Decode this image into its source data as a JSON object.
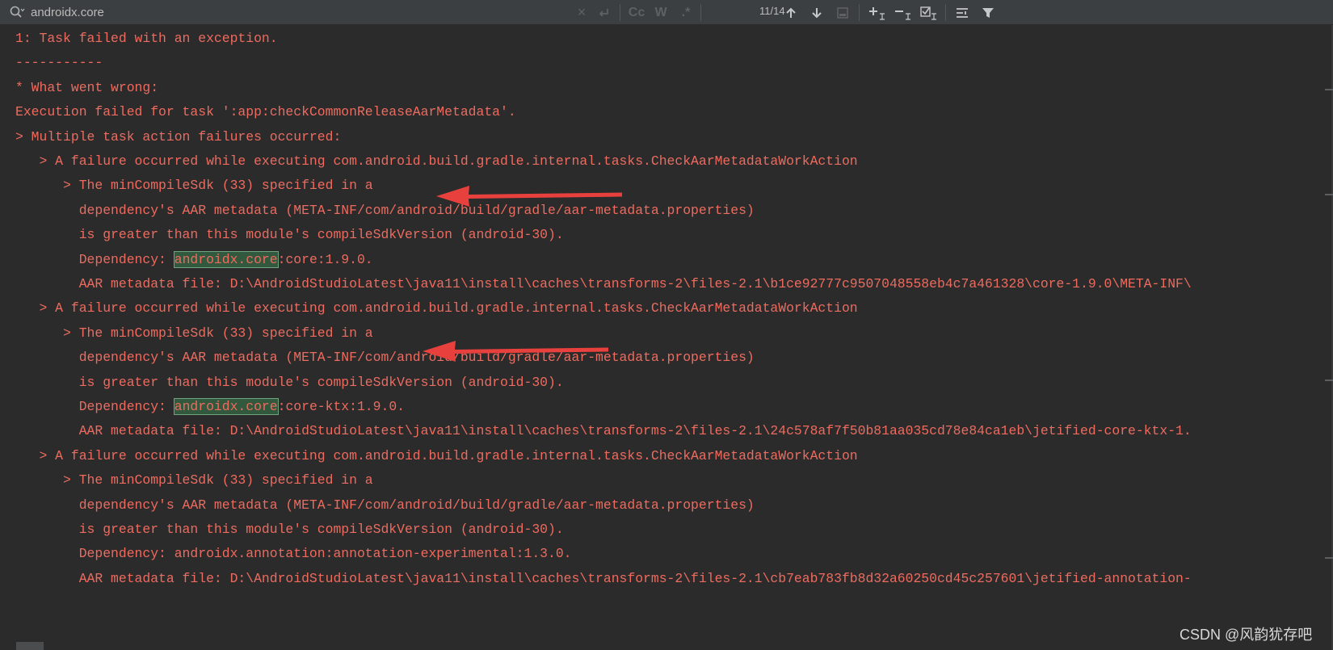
{
  "search": {
    "value": "androidx.core",
    "match_counter": "11/14",
    "toggle_case": "Cc",
    "toggle_words": "W",
    "toggle_regex": ".*"
  },
  "console": {
    "lines": [
      "1: Task failed with an exception.",
      "-----------",
      "* What went wrong:",
      "Execution failed for task ':app:checkCommonReleaseAarMetadata'.",
      "> Multiple task action failures occurred:",
      "   > A failure occurred while executing com.android.build.gradle.internal.tasks.CheckAarMetadataWorkAction",
      "      > The minCompileSdk (33) specified in a",
      "        dependency's AAR metadata (META-INF/com/android/build/gradle/aar-metadata.properties)",
      "        is greater than this module's compileSdkVersion (android-30).",
      {
        "prefix": "        Dependency: ",
        "match": "androidx.core",
        "suffix": ":core:1.9.0."
      },
      "        AAR metadata file: D:\\AndroidStudioLatest\\java11\\install\\caches\\transforms-2\\files-2.1\\b1ce92777c9507048558eb4c7a461328\\core-1.9.0\\META-INF\\",
      "   > A failure occurred while executing com.android.build.gradle.internal.tasks.CheckAarMetadataWorkAction",
      "      > The minCompileSdk (33) specified in a",
      "        dependency's AAR metadata (META-INF/com/android/build/gradle/aar-metadata.properties)",
      "        is greater than this module's compileSdkVersion (android-30).",
      {
        "prefix": "        Dependency: ",
        "match": "androidx.core",
        "suffix": ":core-ktx:1.9.0."
      },
      "        AAR metadata file: D:\\AndroidStudioLatest\\java11\\install\\caches\\transforms-2\\files-2.1\\24c578af7f50b81aa035cd78e84ca1eb\\jetified-core-ktx-1.",
      "   > A failure occurred while executing com.android.build.gradle.internal.tasks.CheckAarMetadataWorkAction",
      "      > The minCompileSdk (33) specified in a",
      "        dependency's AAR metadata (META-INF/com/android/build/gradle/aar-metadata.properties)",
      "        is greater than this module's compileSdkVersion (android-30).",
      "        Dependency: androidx.annotation:annotation-experimental:1.3.0.",
      "        AAR metadata file: D:\\AndroidStudioLatest\\java11\\install\\caches\\transforms-2\\files-2.1\\cb7eab783fb8d32a60250cd45c257601\\jetified-annotation-"
    ]
  },
  "colors": {
    "error_text": "#ed6b5f",
    "background": "#2b2b2b",
    "toolbar": "#3c3f41",
    "match_highlight": "#32593d",
    "arrow": "#e8403c"
  },
  "icons": [
    "search-icon",
    "clear-icon",
    "newline-icon",
    "arrow-up-icon",
    "arrow-down-icon",
    "select-all-icon",
    "add-selection-icon",
    "remove-selection-icon",
    "select-all-occurrences-icon",
    "filter-settings-icon",
    "filter-icon"
  ],
  "watermark": "CSDN @风韵犹存吧"
}
